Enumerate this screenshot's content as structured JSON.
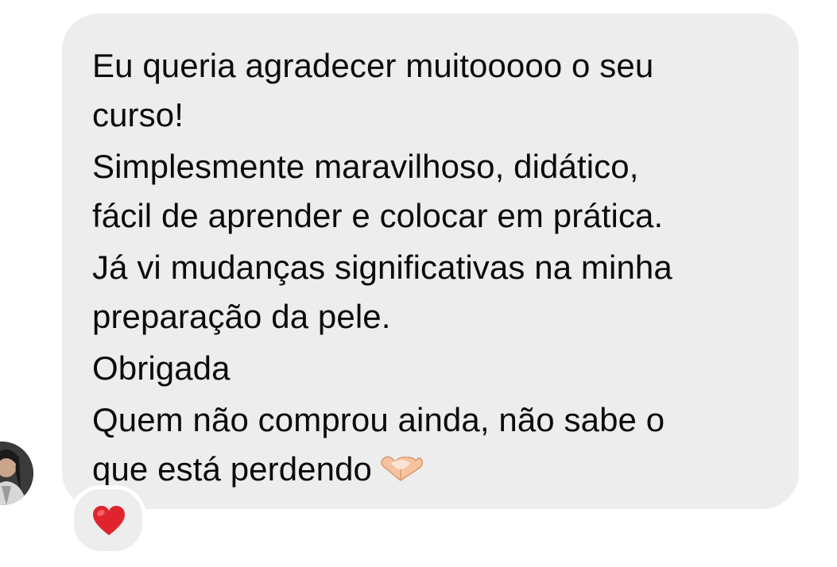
{
  "message": {
    "lines": [
      "Eu queria agradecer muitooooo o seu",
      "curso!",
      "Simplesmente maravilhoso, didático,",
      "fácil de aprender e colocar em prática.",
      "Já vi mudanças significativas na minha",
      "preparação da pele.",
      "Obrigada",
      "Quem não comprou ainda, não sabe o",
      "que está perdendo"
    ],
    "trailing_emoji": "heart-hands-icon",
    "bubble_color": "#ededee",
    "text_color": "#0b0b0b"
  },
  "reaction": {
    "emoji": "red-heart-icon",
    "color": "#e0242e"
  },
  "sender": {
    "avatar": "avatar"
  }
}
